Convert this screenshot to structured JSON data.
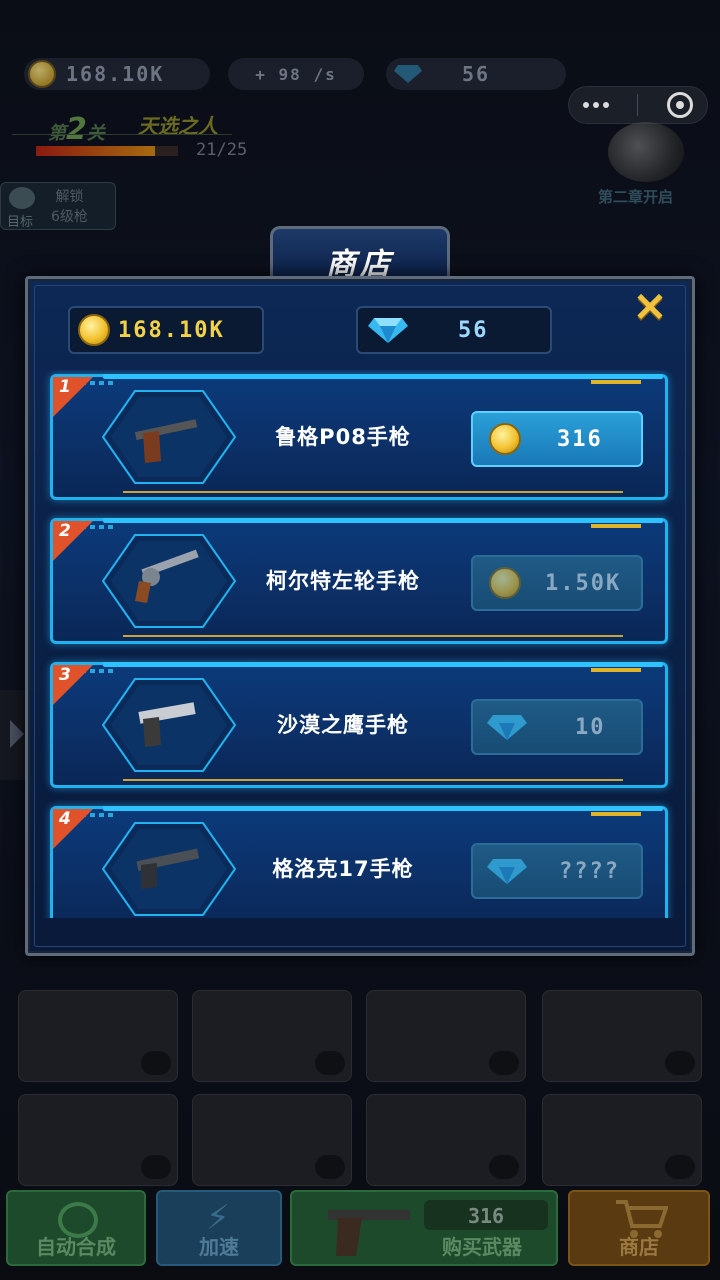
{
  "hud": {
    "coins": "168.10K",
    "income": "+ 98 /s",
    "gems": "56",
    "level_prefix": "第",
    "level_number": "2",
    "level_suffix": "关",
    "level_title": "天选之人",
    "exp_text": "21/25",
    "exp_progress": 0.84,
    "goal_label": "目标",
    "goal_text_line1": "解锁",
    "goal_text_line2": "6级枪",
    "chapter_text": "第二章开启"
  },
  "bottom_bar": {
    "auto_merge": "自动合成",
    "speed_up": "加速",
    "buy_price": "316",
    "buy_label": "购买武器",
    "shop": "商店"
  },
  "shop": {
    "title": "商店",
    "close_icon": "close-x-icon",
    "coins": "168.10K",
    "gems": "56",
    "items": [
      {
        "rank": "1",
        "name": "鲁格P08手枪",
        "currency": "coin",
        "price": "316",
        "affordable": true
      },
      {
        "rank": "2",
        "name": "柯尔特左轮手枪",
        "currency": "coin",
        "price": "1.50K",
        "affordable": false
      },
      {
        "rank": "3",
        "name": "沙漠之鹰手枪",
        "currency": "gem",
        "price": "10",
        "affordable": false
      },
      {
        "rank": "4",
        "name": "格洛克17手枪",
        "currency": "gem",
        "price": "????",
        "affordable": false
      }
    ]
  },
  "colors": {
    "accent": "#1fb4f0",
    "coin": "#f2c230",
    "gem": "#37b8f0",
    "rank_badge": "#e0522a",
    "close": "#f0c23e"
  }
}
